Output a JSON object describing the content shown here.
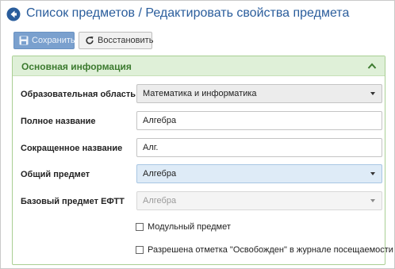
{
  "header": {
    "title": "Список предметов / Редактировать свойства предмета",
    "back_icon": "circle-arrow-left-icon"
  },
  "toolbar": {
    "save_label": "Сохранить",
    "save_icon": "floppy-disk-icon",
    "restore_label": "Восстановить",
    "restore_icon": "refresh-icon"
  },
  "panel": {
    "title": "Основная информация",
    "collapse_icon": "chevron-up-icon",
    "fields": {
      "area": {
        "label": "Образовательная область",
        "value": "Математика и информатика"
      },
      "full_name": {
        "label": "Полное название",
        "value": "Алгебра"
      },
      "short_name": {
        "label": "Сокращенное название",
        "value": "Алг."
      },
      "common_subject": {
        "label": "Общий предмет",
        "value": "Алгебра"
      },
      "base_subject": {
        "label": "Базовый предмет ЕФТТ",
        "value": "Алгебра"
      }
    },
    "checkboxes": {
      "modular": {
        "label": "Модульный предмет",
        "checked": false
      },
      "exempt_mark": {
        "label": "Разрешена отметка \"Освобожден\" в журнале посещаемости",
        "checked": false
      }
    }
  },
  "colors": {
    "title_blue": "#2a5d9c",
    "panel_header_bg": "#dff0d8",
    "panel_title_green": "#3c7a2f",
    "save_button_bg": "#7aa0ce",
    "select_blue_bg": "#deebf7"
  }
}
